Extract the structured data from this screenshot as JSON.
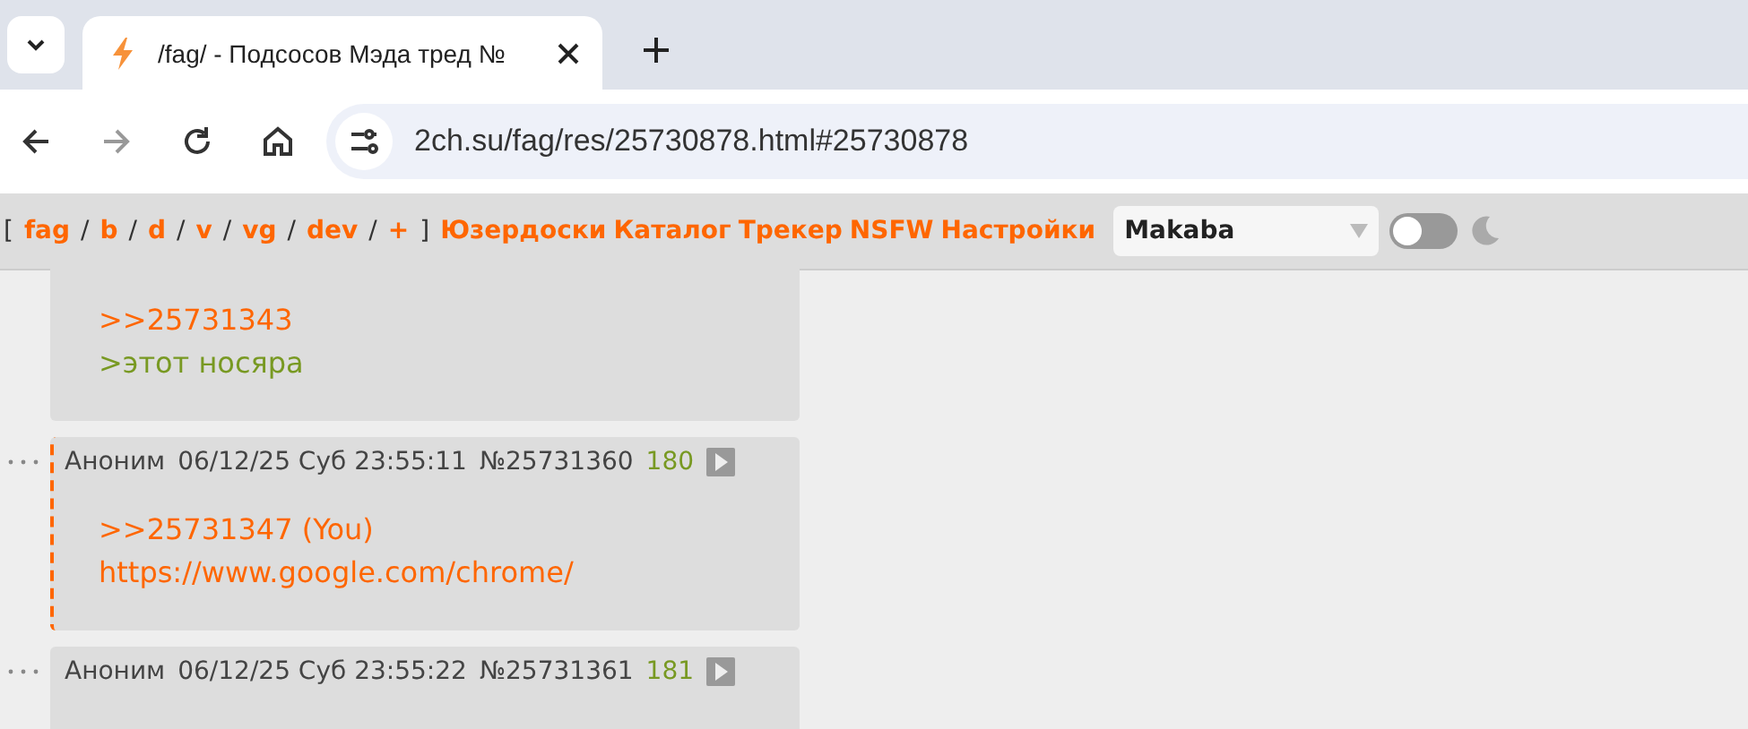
{
  "browser": {
    "tab": {
      "title": "/fag/ - Подсосов Мэда тред №"
    },
    "address": "2ch.su/fag/res/25730878.html#25730878"
  },
  "nav": {
    "open_bracket": "[",
    "close_bracket": "]",
    "separator": "/",
    "boards": [
      "fag",
      "b",
      "d",
      "v",
      "vg",
      "dev",
      "+"
    ],
    "links": [
      "Юзердоски",
      "Каталог",
      "Трекер",
      "NSFW",
      "Настройки"
    ],
    "style_select": "Makaba",
    "dark_mode": false
  },
  "posts": [
    {
      "marked": false,
      "lines": [
        {
          "kind": "reply",
          "text": ">>25731343"
        },
        {
          "kind": "quote",
          "text": ">этот носяра"
        }
      ]
    },
    {
      "marked": true,
      "header": {
        "name": "Аноним",
        "date": "06/12/25 Суб 23:55:11",
        "number": "№25731360",
        "count": "180"
      },
      "lines": [
        {
          "kind": "reply",
          "text": ">>25731347 (You)"
        },
        {
          "kind": "link",
          "text": "https://www.google.com/chrome/"
        }
      ]
    },
    {
      "marked": false,
      "header": {
        "name": "Аноним",
        "date": "06/12/25 Суб 23:55:22",
        "number": "№25731361",
        "count": "181"
      }
    }
  ]
}
